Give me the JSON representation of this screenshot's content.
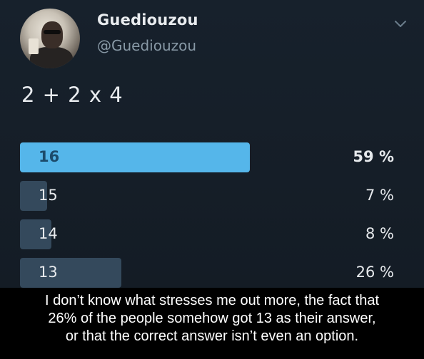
{
  "tweet": {
    "display_name": "Guediouzou",
    "handle": "@Guediouzou",
    "text": "2 + 2 x 4",
    "menu_icon": "chevron-down-icon",
    "avatar_icon": "profile-photo"
  },
  "poll": {
    "options": [
      {
        "label": "16",
        "percent_text": "59 %",
        "percent": 59,
        "winner": true
      },
      {
        "label": "15",
        "percent_text": "7 %",
        "percent": 7,
        "winner": false
      },
      {
        "label": "14",
        "percent_text": "8 %",
        "percent": 8,
        "winner": false
      },
      {
        "label": "13",
        "percent_text": "26 %",
        "percent": 26,
        "winner": false
      }
    ]
  },
  "caption": {
    "lines": [
      "I don’t know what stresses me out more, the fact that",
      "26% of the people somehow got 13 as their answer,",
      "or that the correct answer isn’t even an option."
    ]
  },
  "colors": {
    "background": "#141d26",
    "winner_bar": "#55b6ea",
    "other_bar": "#34495c",
    "text": "#e9ecef",
    "handle": "#8899a6",
    "caption_bg": "#000000",
    "caption_text": "#ffffff"
  }
}
